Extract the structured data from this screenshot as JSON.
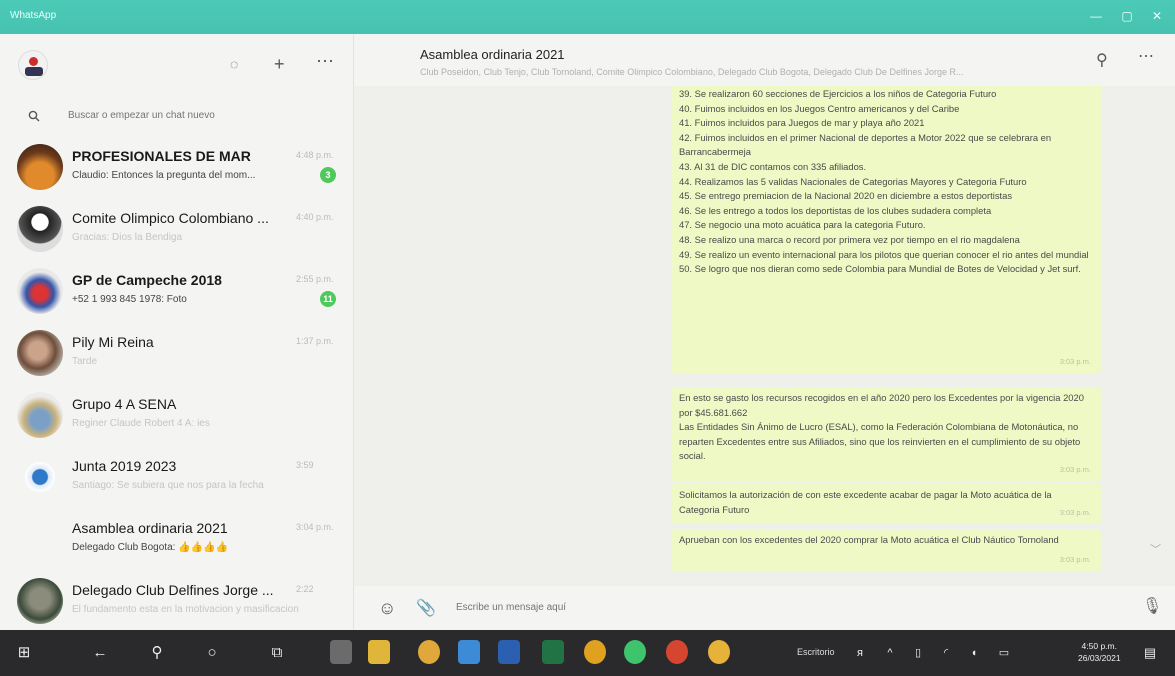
{
  "window": {
    "title": "WhatsApp"
  },
  "search": {
    "placeholder": "Buscar o empezar un chat nuevo"
  },
  "chats": [
    {
      "name": "PROFESIONALES DE MAR",
      "preview": "Claudio: Entonces la pregunta del mom...",
      "time": "4:48 p.m.",
      "badge": "3",
      "bold": true
    },
    {
      "name": "Comite Olimpico Colombiano ...",
      "preview": "Gracias: Dios la Bendiga",
      "time": "4:40 p.m."
    },
    {
      "name": "GP de Campeche 2018",
      "preview": "+52 1 993 845 1978: Foto",
      "time": "2:55 p.m.",
      "badge": "11",
      "bold": true
    },
    {
      "name": "Pily Mi Reina",
      "preview": "Tarde",
      "time": "1:37 p.m."
    },
    {
      "name": "Grupo 4 A SENA",
      "preview": "Reginer Claude Robert 4 A: ies",
      "time": ""
    },
    {
      "name": "Junta 2019 2023",
      "preview": "Santiago: Se subiera que nos para la fecha",
      "time": "3:59"
    },
    {
      "name": "Asamblea ordinaria 2021",
      "preview": "Delegado Club Bogota: 👍👍👍👍",
      "time": "3:04 p.m."
    },
    {
      "name": "Delegado Club Delfines Jorge ...",
      "preview": "El fundamento esta en la motivacion y masificacion",
      "time": "2:22"
    }
  ],
  "conversation": {
    "title": "Asamblea ordinaria 2021",
    "members": "Club Poseidon, Club Tenjo, Club Tornoland, Comite Olimpico Colombiano, Delegado Club Bogota, Delegado Club De Delfines Jorge R..."
  },
  "messages": [
    {
      "lines": [
        "39.  Se realizaron 60 secciones de Ejercicios a los niños de Categoria Futuro",
        "40.  Fuimos incluidos en los Juegos Centro americanos y del Caribe",
        "41.  Fuimos incluidos para Juegos de mar y playa año 2021",
        "42.  Fuimos incluidos en el primer Nacional de deportes a Motor 2022 que se celebrara en Barrancabermeja",
        "43.  Al 31 de DIC contamos con 335 afiliados.",
        "44.  Realizamos las 5 validas Nacionales de Categorias Mayores y Categoria Futuro",
        "45.  Se entrego premiacion de la Nacional 2020 en diciembre a estos deportistas",
        "46.  Se les entrego a todos los deportistas de los clubes sudadera completa",
        "47.  Se negocio una moto acuática para la categoria Futuro.",
        "48.  Se realizo una marca o record por primera vez por tiempo en el rio magdalena",
        "49.  Se realizo un evento internacional para los pilotos que querian conocer el rio antes del mundial",
        "50.  Se logro que nos dieran como sede Colombia para Mundial de Botes de Velocidad y Jet surf."
      ],
      "time": "3:03 p.m."
    },
    {
      "lines": [
        "En esto se gasto los recursos recogidos en el año 2020 pero los Excedentes por la vigencia 2020 por $45.681.662",
        "Las Entidades Sin Ánimo de Lucro (ESAL), como la Federación Colombiana de Motonáutica, no reparten Excedentes entre sus Afiliados, sino que los reinvierten en el cumplimiento de su objeto social."
      ],
      "time": "3:03 p.m."
    },
    {
      "lines": [
        "Solicitamos la autorización de con este excedente acabar de pagar la Moto acuática de la Categoria Futuro"
      ],
      "time": "3:03 p.m."
    },
    {
      "lines": [
        "Aprueban con los excedentes del 2020 comprar la Moto acuática el Club Náutico Tornoland"
      ],
      "time": "3:03 p.m."
    }
  ],
  "composer": {
    "placeholder": "Escribe un mensaje aquí"
  },
  "taskbar": {
    "desktop_label": "Escritorio",
    "clock_time": "4:50 p.m.",
    "clock_date": "26/03/2021"
  },
  "colors": {
    "titlebar": "#4ccab8",
    "bubble": "#eef9c6",
    "badge": "#4fc95c",
    "chat_background": "#efefec",
    "taskbar": "#2a2a2c"
  }
}
